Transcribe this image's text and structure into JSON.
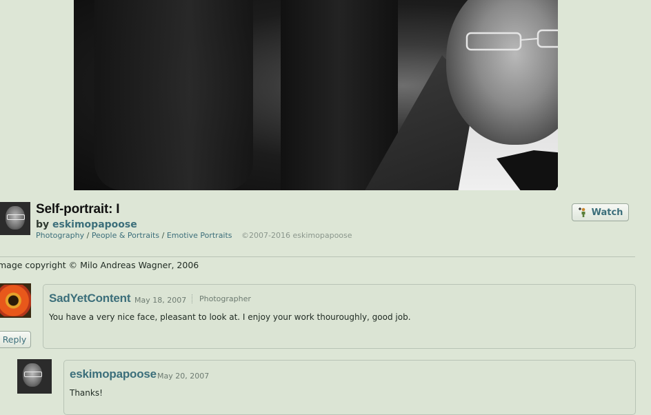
{
  "photo": {
    "alt": ""
  },
  "deviation": {
    "title": "Self-portrait: I",
    "by_label": "by",
    "author": "eskimopapoose",
    "categories": [
      "Photography",
      "People & Portraits",
      "Emotive Portraits"
    ],
    "separator": "/",
    "copyright": "©2007-2016 eskimopapoose",
    "watch_label": "Watch",
    "note": "mage copyright © Milo Andreas Wagner, 2006"
  },
  "comments": [
    {
      "author": "SadYetContent",
      "date": "May 18, 2007",
      "role": "Photographer",
      "text": "You have a very nice face, pleasant to look at. I enjoy your work thouroughly, good job.",
      "reply_label": "Reply"
    },
    {
      "author": "eskimopapoose",
      "date": "May 20, 2007",
      "text": "Thanks!"
    }
  ],
  "colors": {
    "background": "#dde6d6",
    "link": "#3b6e7a"
  }
}
